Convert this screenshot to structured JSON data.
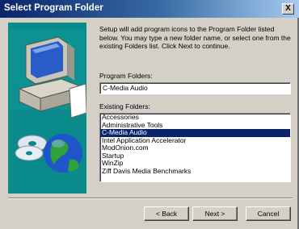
{
  "window": {
    "title": "Select Program Folder",
    "close_glyph": "X"
  },
  "message": "Setup will add program icons to the Program Folder listed below. You may type a new folder name, or select one from the existing Folders list.  Click Next to continue.",
  "program_folder": {
    "label": "Program Folders:",
    "value": "C-Media Audio"
  },
  "existing_folders": {
    "label": "Existing Folders:",
    "items": [
      "Accessories",
      "Administrative Tools",
      "C-Media Audio",
      "Intel Application Accelerator",
      "ModOnion.com",
      "Startup",
      "WinZip",
      "Ziff Davis Media Benchmarks"
    ],
    "selected_index": 2
  },
  "buttons": {
    "back": "< Back",
    "next": "Next >",
    "cancel": "Cancel"
  },
  "colors": {
    "title_start": "#0a246a",
    "selection": "#0a246a",
    "art_background": "#0a8a8a"
  }
}
